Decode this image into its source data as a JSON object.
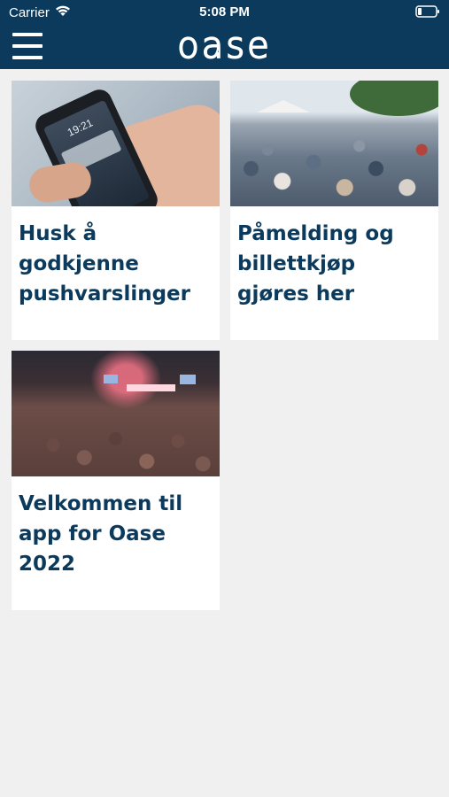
{
  "status_bar": {
    "carrier": "Carrier",
    "time": "5:08 PM",
    "wifi_icon": "wifi-icon",
    "battery_icon": "battery-icon"
  },
  "header": {
    "logo_text": "oase",
    "menu_icon": "hamburger-menu-icon",
    "background_color": "#0b3a5c"
  },
  "cards": [
    {
      "title": "Husk å godkjenne pushvarslinger",
      "image": "phone-notification-photo"
    },
    {
      "title": "Påmelding og billettkjøp gjøres her",
      "image": "crowd-photo"
    },
    {
      "title": "Velkommen til app for Oase 2022",
      "image": "concert-hall-photo"
    }
  ],
  "colors": {
    "accent": "#0b3a5c",
    "page_background": "#f0f0f0",
    "card_background": "#ffffff"
  }
}
